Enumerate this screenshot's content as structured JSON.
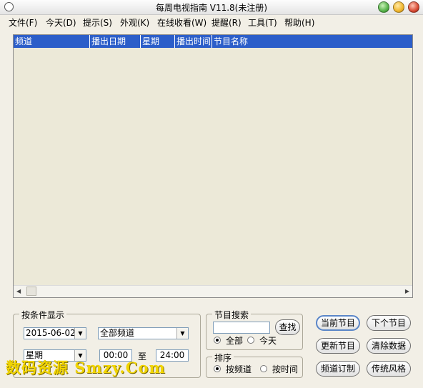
{
  "window": {
    "title": "每周电视指南  V11.8(未注册)",
    "controls": {
      "minimize": "#57b34a",
      "maximize": "#f0b62e",
      "close": "#d84a33"
    }
  },
  "menu": [
    {
      "label": "文件(F)"
    },
    {
      "label": "今天(D)"
    },
    {
      "label": "提示(S)"
    },
    {
      "label": "外观(K)"
    },
    {
      "label": "在线收看(W)"
    },
    {
      "label": "提醒(R)"
    },
    {
      "label": "工具(T)"
    },
    {
      "label": "帮助(H)"
    }
  ],
  "table": {
    "header_color": "#2c5ec9",
    "columns": [
      "频道",
      "播出日期",
      "星期",
      "播出时间",
      "节目名称"
    ],
    "rows": []
  },
  "filter": {
    "legend": "按条件显示",
    "date": "2015-06-02",
    "channel": "全部频道",
    "weekday": "星期",
    "time_from": "00:00",
    "to_label": "至",
    "time_to": "24:00"
  },
  "search": {
    "legend": "节目搜索",
    "input_value": "",
    "button": "查找",
    "options": [
      "全部",
      "今天"
    ],
    "selected": "全部"
  },
  "sort": {
    "legend": "排序",
    "options": [
      "按频道",
      "按时间"
    ],
    "selected": "按频道"
  },
  "buttons": {
    "current": "当前节目",
    "next": "下个节目",
    "update": "更新节目",
    "clear": "清除数据",
    "subscribe": "频道订制",
    "classic": "传统风格"
  },
  "watermark": "数码资源 Smzy.Com"
}
